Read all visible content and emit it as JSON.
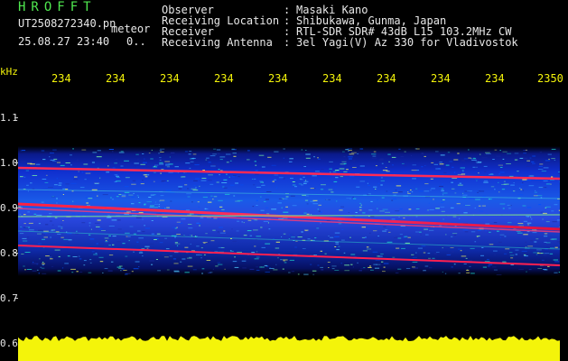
{
  "header": {
    "brand": "HROFFT",
    "filename": "UT2508272340.pn",
    "mode": "meteor",
    "datetime": "25.08.27 23:40",
    "count": "0..",
    "rows": [
      {
        "label": "Observer",
        "sep": ":",
        "value": "Masaki Kano"
      },
      {
        "label": "Receiving Location",
        "sep": ":",
        "value": "Shibukawa, Gunma, Japan"
      },
      {
        "label": "Receiver",
        "sep": ":",
        "value": "RTL-SDR SDR# 43dB L15 103.2MHz CW"
      },
      {
        "label": "Receiving Antenna",
        "sep": ":",
        "value": "3el Yagi(V) Az 330 for Vladivostok"
      }
    ]
  },
  "axes": {
    "y_unit": "kHz",
    "x_ticks": [
      "234",
      "234",
      "234",
      "234",
      "234",
      "234",
      "234",
      "234",
      "234",
      "2350"
    ],
    "y_ticks": [
      "1.1",
      "1.0",
      "0.9",
      "0.8",
      "0.7",
      "0.6"
    ]
  },
  "colors": {
    "background": "#000000",
    "header_text": "#e8e8e8",
    "brand": "#4fe84f",
    "axis_labels": "#f4f40a",
    "power_bar": "#f4f40a"
  }
}
